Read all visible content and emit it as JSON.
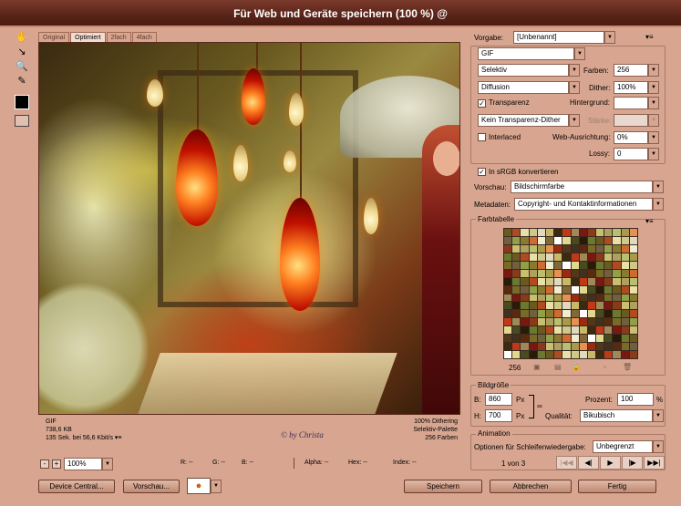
{
  "title": "Für Web und Geräte speichern (100 %) @",
  "tabs": [
    "Original",
    "Optimiert",
    "2fach",
    "4fach"
  ],
  "preview_info": {
    "left": [
      "GIF",
      "738,6 KB",
      "135 Sek. bei 56,6 Kbit/s"
    ],
    "right": [
      "100% Dithering",
      "Selektiv-Palette",
      "256 Farben"
    ]
  },
  "watermark": "© by Christa",
  "zoom": "100%",
  "status": {
    "r": "R: --",
    "g": "G: --",
    "b": "B: --",
    "alpha": "Alpha: --",
    "hex": "Hex: --",
    "index": "Index: --"
  },
  "settings": {
    "vorgabe_label": "Vorgabe:",
    "vorgabe": "[Unbenannt]",
    "format": "GIF",
    "reduction": "Selektiv",
    "farben_label": "Farben:",
    "farben": "256",
    "dither_algo": "Diffusion",
    "dither_label": "Dither:",
    "dither": "100%",
    "transparenz": "Transparenz",
    "hintergrund_label": "Hintergrund:",
    "trans_dither": "Kein Transparenz-Dither",
    "staerke_label": "Stärke:",
    "interlaced": "Interlaced",
    "web_label": "Web-Ausrichtung:",
    "web": "0%",
    "lossy_label": "Lossy:",
    "lossy": "0",
    "srgb": "In sRGB konvertieren",
    "vorschau_label": "Vorschau:",
    "vorschau": "Bildschirmfarbe",
    "metadaten_label": "Metadaten:",
    "metadaten": "Copyright- und Kontaktinformationen"
  },
  "farbtabelle": {
    "title": "Farbtabelle",
    "count": "256"
  },
  "bildgroesse": {
    "title": "Bildgröße",
    "b_label": "B:",
    "b": "860",
    "h_label": "H:",
    "h": "700",
    "unit": "Px",
    "prozent_label": "Prozent:",
    "prozent": "100",
    "prozent_unit": "%",
    "qualitaet_label": "Qualität:",
    "qualitaet": "Bikubisch"
  },
  "animation": {
    "title": "Animation",
    "loop_label": "Optionen für Schleifenwiedergabe:",
    "loop": "Unbegrenzt",
    "frame": "1 von 3"
  },
  "buttons": {
    "device": "Device Central...",
    "vorschau": "Vorschau...",
    "speichern": "Speichern",
    "abbrechen": "Abbrechen",
    "fertig": "Fertig"
  },
  "palette_colors": [
    "#6a5a20",
    "#8a7a30",
    "#a89a48",
    "#c8b868",
    "#e0d890",
    "#5a2a10",
    "#8a3a18",
    "#b04a20",
    "#d06a30",
    "#e89050",
    "#3a2a10",
    "#4a4a20",
    "#7a6a28",
    "#c8c070",
    "#e8e0a8",
    "#f0ecd0",
    "#9a2a10",
    "#c03818",
    "#2a1a08",
    "#706040",
    "#b0a060",
    "#d0c888",
    "#806838",
    "#503818",
    "#a08858",
    "#6a7830",
    "#90a048",
    "#b8c070",
    "#e0d8c0",
    "#ffffff",
    "#403020",
    "#781810"
  ]
}
